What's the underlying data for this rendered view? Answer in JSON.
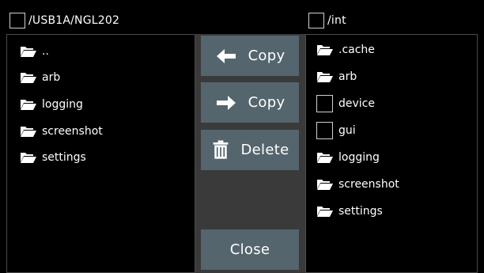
{
  "left": {
    "path": "/USB1A/NGL202",
    "items": [
      {
        "label": "..",
        "icon": "folder-icon"
      },
      {
        "label": "arb",
        "icon": "folder-icon"
      },
      {
        "label": "logging",
        "icon": "folder-icon"
      },
      {
        "label": "screenshot",
        "icon": "folder-icon"
      },
      {
        "label": "settings",
        "icon": "folder-icon"
      }
    ]
  },
  "right": {
    "path": "/int",
    "items": [
      {
        "label": ".cache",
        "icon": "folder-icon"
      },
      {
        "label": "arb",
        "icon": "folder-icon"
      },
      {
        "label": "device",
        "icon": "checkbox"
      },
      {
        "label": "gui",
        "icon": "checkbox"
      },
      {
        "label": "logging",
        "icon": "folder-icon"
      },
      {
        "label": "screenshot",
        "icon": "folder-icon"
      },
      {
        "label": "settings",
        "icon": "folder-icon"
      }
    ]
  },
  "buttons": {
    "copy_left": "Copy",
    "copy_right": "Copy",
    "delete": "Delete",
    "close": "Close"
  },
  "colors": {
    "background": "#000000",
    "button": "#54656d",
    "gutter": "#3a3a3a",
    "panel_border": "#4a4a4a",
    "text": "#ffffff"
  }
}
